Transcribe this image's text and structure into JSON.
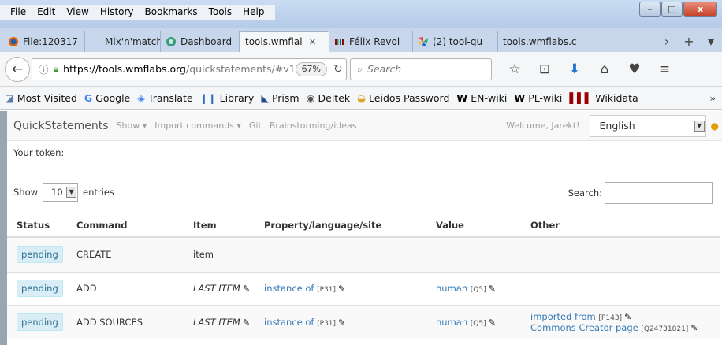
{
  "menu": [
    "File",
    "Edit",
    "View",
    "History",
    "Bookmarks",
    "Tools",
    "Help"
  ],
  "window_buttons": {
    "minimize": "–",
    "maximize": "□",
    "close": "x"
  },
  "tabs": [
    {
      "label": "File:120317",
      "icon": "firefox-icon",
      "active": false
    },
    {
      "label": "Mix'n'match",
      "icon": "",
      "active": false
    },
    {
      "label": "Dashboard",
      "icon": "dashboard-icon",
      "active": false
    },
    {
      "label": "tools.wmflal",
      "icon": "",
      "active": true,
      "close": "×"
    },
    {
      "label": "Félix Revol",
      "icon": "wikidata-icon",
      "active": false
    },
    {
      "label": "(2) tool-qu",
      "icon": "pinwheel-icon",
      "active": false
    },
    {
      "label": "tools.wmflabs.c",
      "icon": "",
      "active": false
    }
  ],
  "tab_nav": {
    "scroll": "›",
    "new_tab": "+",
    "list": "▾"
  },
  "navbar": {
    "back": "←",
    "url_host": "https://tools.wmflabs.org",
    "url_rest": "/quickstatements/#v1",
    "zoom": "67%",
    "reload": "↻",
    "search_placeholder": "Search",
    "icons": [
      "☆",
      "⊡",
      "⬇",
      "⌂",
      "♥",
      "≡"
    ]
  },
  "bookmarks": [
    {
      "label": "Most Visited",
      "icon": "most-visited-icon",
      "glyph": "◪",
      "color": "#5a7ab0"
    },
    {
      "label": "Google",
      "icon": "google-icon",
      "glyph": "G",
      "color": "#4285f4"
    },
    {
      "label": "Translate",
      "icon": "translate-icon",
      "glyph": "◈",
      "color": "#4285f4"
    },
    {
      "label": "Library",
      "icon": "library-icon",
      "glyph": "❙❙",
      "color": "#2f6fba"
    },
    {
      "label": "Prism",
      "icon": "prism-icon",
      "glyph": "◣",
      "color": "#1f4d8c"
    },
    {
      "label": "Deltek",
      "icon": "deltek-icon",
      "glyph": "◉",
      "color": "#555"
    },
    {
      "label": "Leidos Password",
      "icon": "leidos-icon",
      "glyph": "◒",
      "color": "#d9a62a"
    },
    {
      "label": "EN-wiki",
      "icon": "wikipedia-icon",
      "glyph": "W",
      "color": "#000"
    },
    {
      "label": "PL-wiki",
      "icon": "wikipedia-icon",
      "glyph": "W",
      "color": "#000"
    },
    {
      "label": "Wikidata",
      "icon": "wikidata-icon",
      "glyph": "▌▌▌",
      "color": "#990000"
    }
  ],
  "bookmarks_more": "»",
  "qs": {
    "brand": "QuickStatements",
    "nav_links": [
      "Show ▾",
      "Import commands ▾",
      "Git",
      "Brainstorming/ideas"
    ],
    "welcome": "Welcome, Jarekt!",
    "language": "English",
    "token_label": "Your token:",
    "show_label": "Show",
    "entries_value": "10",
    "entries_label": "entries",
    "search_label": "Search:"
  },
  "table": {
    "headers": [
      "Status",
      "Command",
      "Item",
      "Property/language/site",
      "Value",
      "Other"
    ],
    "rows": [
      {
        "status": "pending",
        "command": "CREATE",
        "item": "item",
        "item_italic": false,
        "property": "",
        "property_id": "",
        "value": "",
        "value_id": "",
        "other": []
      },
      {
        "status": "pending",
        "command": "ADD",
        "item": "LAST ITEM",
        "item_italic": true,
        "property": "instance of",
        "property_id": "[P31]",
        "value": "human",
        "value_id": "[Q5]",
        "other": []
      },
      {
        "status": "pending",
        "command": "ADD SOURCES",
        "item": "LAST ITEM",
        "item_italic": true,
        "property": "instance of",
        "property_id": "[P31]",
        "value": "human",
        "value_id": "[Q5]",
        "other": [
          {
            "label": "imported from",
            "id": "[P143]"
          },
          {
            "label": "Commons Creator page",
            "id": "[Q24731821]"
          }
        ]
      }
    ]
  }
}
